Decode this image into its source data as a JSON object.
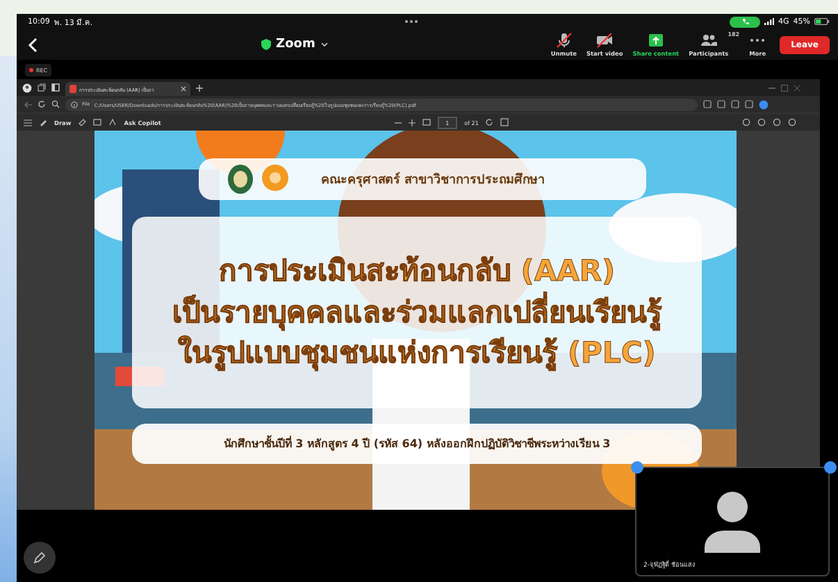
{
  "status_bar": {
    "time": "10:09",
    "date": "พ. 13 มี.ค.",
    "network": "4G",
    "battery": "45%"
  },
  "meeting_bar": {
    "title": "Zoom",
    "controls": [
      {
        "kind": "mic",
        "label": "Unmute",
        "off": true
      },
      {
        "kind": "video",
        "label": "Start video",
        "off": true
      },
      {
        "kind": "share",
        "label": "Share content",
        "off": false
      },
      {
        "kind": "participants",
        "label": "Participants",
        "count": "182",
        "off": false
      },
      {
        "kind": "more",
        "label": "More",
        "off": false
      }
    ],
    "leave": "Leave"
  },
  "recording": "REC",
  "browser": {
    "tab_title": "การประเมินสะท้อนกลับ (AAR) เป็นรา",
    "url_scheme": "File",
    "url": "C:/Users/USER/Downloads/การประเมินสะท้อนกลับ%20(AAR)%20เป็นรายบุคคลและร่วมแลกเปลี่ยนเรียนรู้%20ในรูปแบบชุมชนแห่งการเรียนรู้%20(PLC).pdf",
    "toolbar": {
      "draw": "Draw",
      "ask": "Ask Copilot",
      "page": "1",
      "page_total": "of 21"
    }
  },
  "slide": {
    "header": "คณะครุศาสตร์ สาขาวิชาการประถมศึกษา",
    "title_lines": [
      "การประเมินสะท้อนกลับ (AAR)",
      "เป็นรายบุคคลและร่วมแลกเปลี่ยนเรียนรู้",
      "ในรูปแบบชุมชนแห่งการเรียนรู้ (PLC)"
    ],
    "subtitle": "นักศึกษาชั้นปีที่ 3 หลักสูตร 4 ปี (รหัส 64) หลังออกฝึกปฏิบัติวิชาชีพระหว่างเรียน 3"
  },
  "video_tile": {
    "name": "2-จุฬัฏฐิติ์ ช้อนแสง"
  }
}
